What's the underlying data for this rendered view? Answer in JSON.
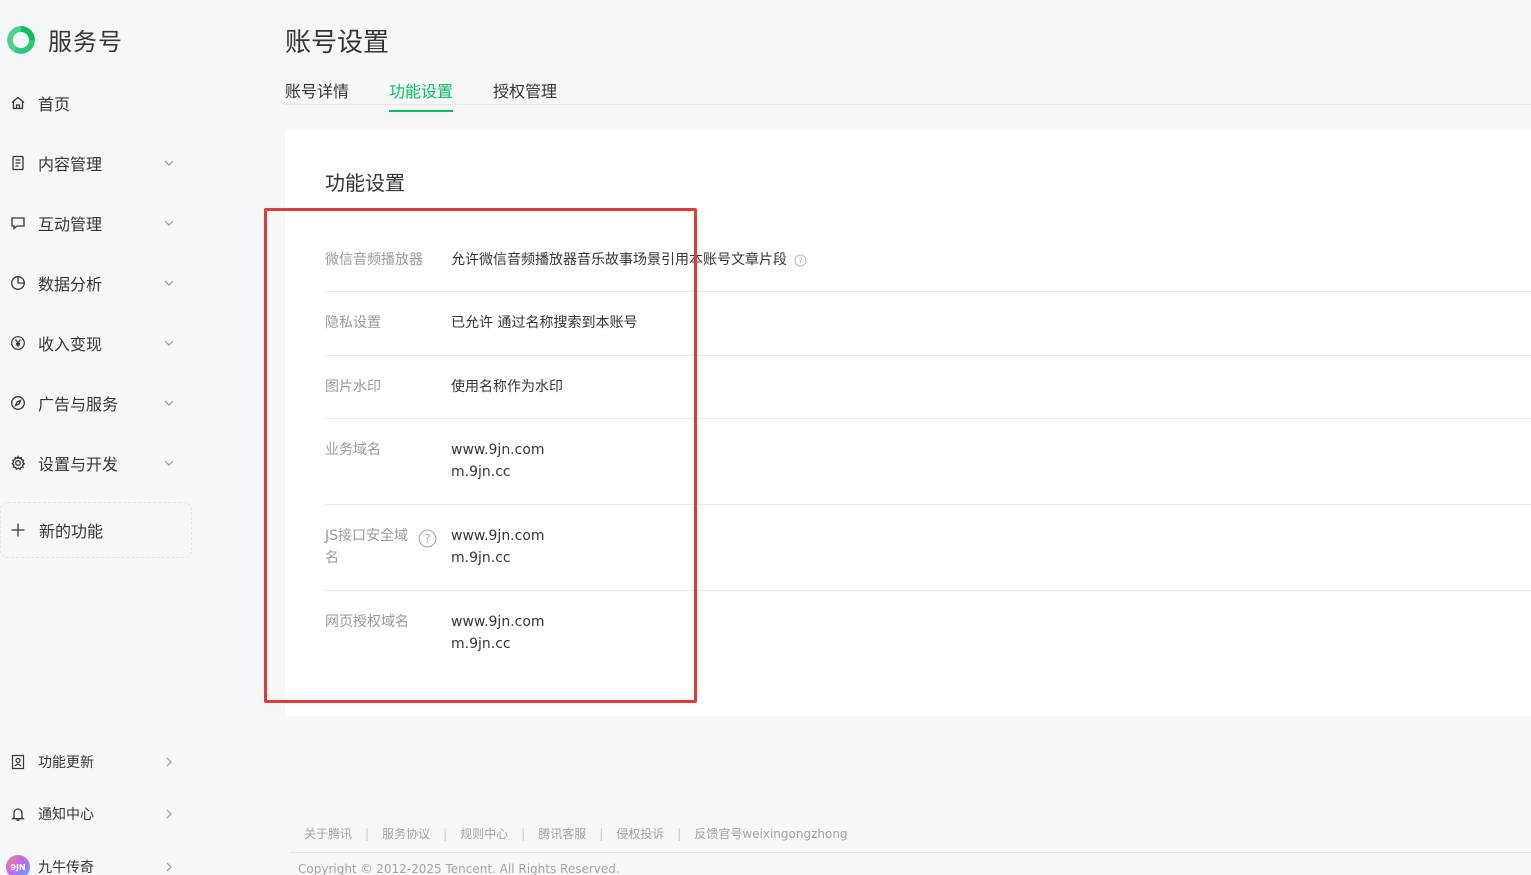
{
  "brand": {
    "name": "服务号",
    "accent": "#07c160"
  },
  "sidebar": {
    "items": [
      {
        "label": "首页",
        "icon": "home-icon"
      },
      {
        "label": "内容管理",
        "icon": "document-icon"
      },
      {
        "label": "互动管理",
        "icon": "message-icon"
      },
      {
        "label": "数据分析",
        "icon": "pie-chart-icon"
      },
      {
        "label": "收入变现",
        "icon": "yen-icon"
      },
      {
        "label": "广告与服务",
        "icon": "compass-icon"
      },
      {
        "label": "设置与开发",
        "icon": "gear-icon"
      }
    ],
    "new_feature": "新的功能",
    "bottom": [
      {
        "label": "功能更新",
        "icon": "update-icon"
      },
      {
        "label": "通知中心",
        "icon": "bell-icon"
      },
      {
        "label": "九牛传奇",
        "icon": "avatar",
        "avatar_text": "9JN"
      }
    ]
  },
  "page": {
    "title": "账号设置",
    "tabs": [
      "账号详情",
      "功能设置",
      "授权管理"
    ],
    "active_tab": "功能设置"
  },
  "settings": {
    "title": "功能设置",
    "rows": [
      {
        "label": "微信音频播放器",
        "lines": [
          "允许微信音频播放器音乐故事场景引用本账号文章片段"
        ]
      },
      {
        "label": "隐私设置",
        "lines": [
          "已允许 通过名称搜索到本账号"
        ]
      },
      {
        "label": "图片水印",
        "lines": [
          "使用名称作为水印"
        ]
      },
      {
        "label": "业务域名",
        "lines": [
          "www.9jn.com",
          "m.9jn.cc"
        ]
      },
      {
        "label_line1": "JS接口安全域",
        "label_line2": "名",
        "lines": [
          "www.9jn.com",
          "m.9jn.cc"
        ]
      },
      {
        "label": "网页授权域名",
        "lines": [
          "www.9jn.com",
          "m.9jn.cc"
        ]
      }
    ]
  },
  "footer": {
    "links": [
      "关于腾讯",
      "服务协议",
      "规则中心",
      "腾讯客服",
      "侵权投诉",
      "反馈官号weixingongzhong"
    ],
    "separator": "|",
    "copyright": "Copyright © 2012-2025 Tencent. All Rights Reserved."
  },
  "colors": {
    "highlight": "#e53935",
    "label_gray": "#9a9a9a"
  }
}
